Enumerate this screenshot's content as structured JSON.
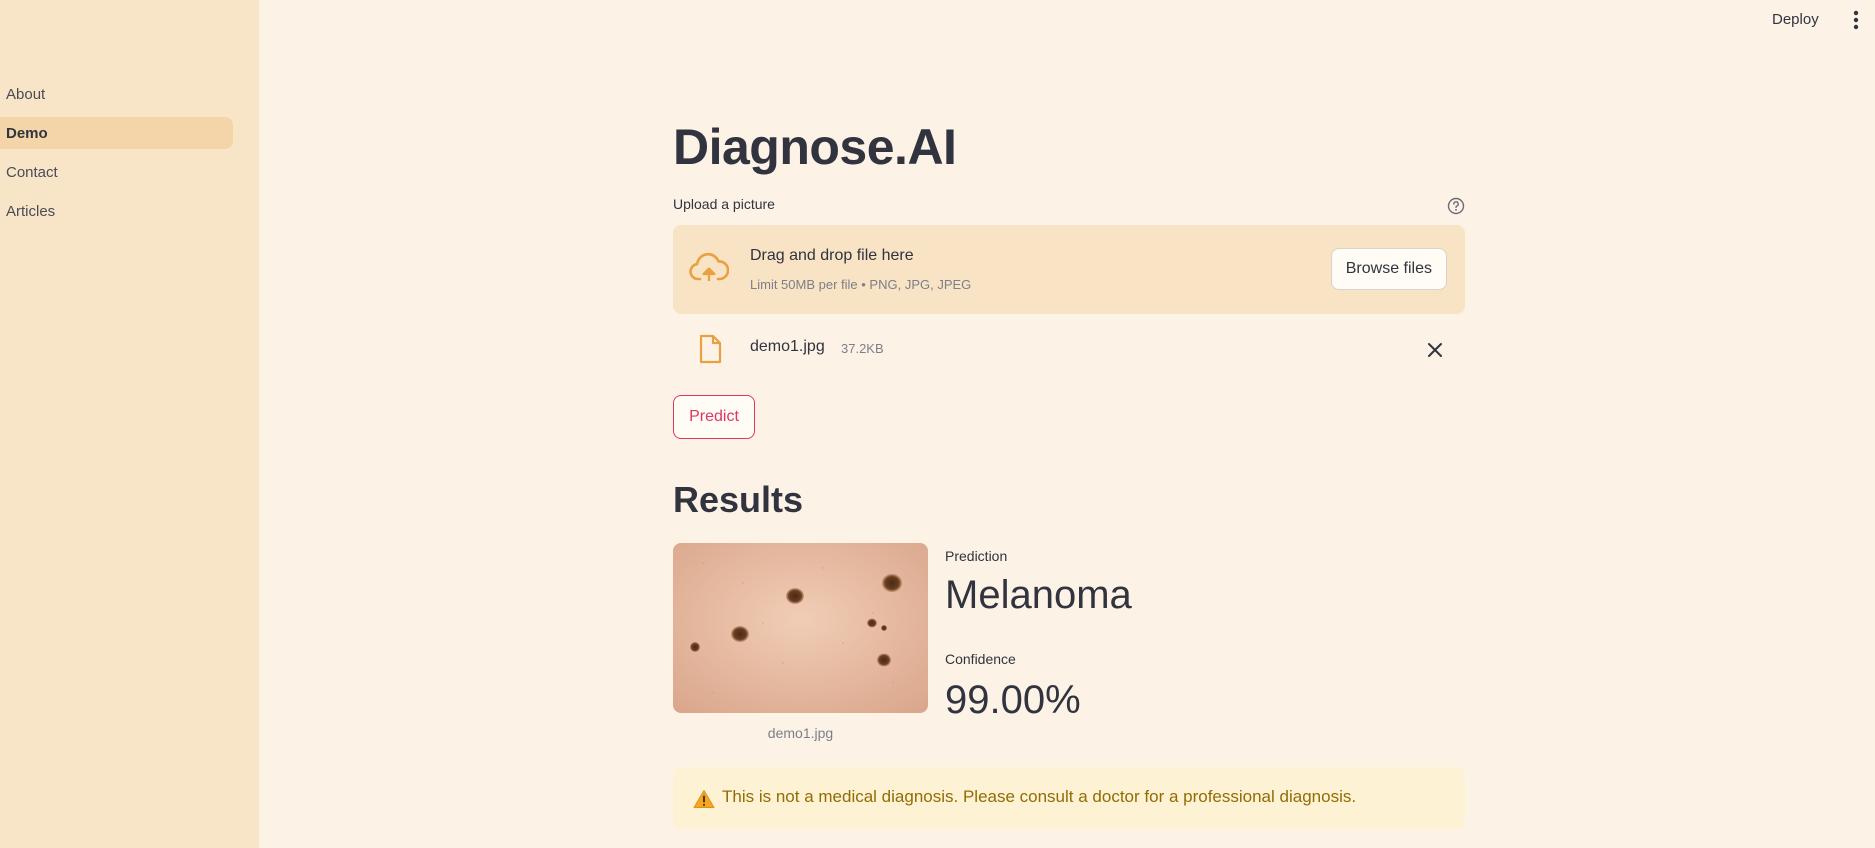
{
  "sidebar": {
    "items": [
      {
        "label": "About",
        "active": false
      },
      {
        "label": "Demo",
        "active": true
      },
      {
        "label": "Contact",
        "active": false
      },
      {
        "label": "Articles",
        "active": false
      }
    ]
  },
  "topbar": {
    "deploy_label": "Deploy",
    "menu_icon": "vertical-ellipsis-icon"
  },
  "main": {
    "title": "Diagnose.AI",
    "uploader": {
      "label": "Upload a picture",
      "help_icon": "question-circle-icon",
      "dropzone_title": "Drag and drop file here",
      "dropzone_subtitle": "Limit 50MB per file • PNG, JPG, JPEG",
      "browse_label": "Browse files",
      "cloud_icon": "cloud-upload-icon"
    },
    "file": {
      "name": "demo1.jpg",
      "size": "37.2KB",
      "icon": "file-icon",
      "remove_icon": "close-icon"
    },
    "predict_label": "Predict",
    "results": {
      "heading": "Results",
      "image_caption": "demo1.jpg",
      "prediction_label": "Prediction",
      "prediction_value": "Melanoma",
      "confidence_label": "Confidence",
      "confidence_value": "99.00%"
    },
    "warning": {
      "icon": "warning-icon",
      "text": "This is not a medical diagnosis. Please consult a doctor for a professional diagnosis."
    }
  },
  "colors": {
    "background": "#fdf2e6",
    "sidebar": "#f8e4c6",
    "accent": "#e0365f",
    "icon_orange": "#e8a040",
    "warning_text": "#926c05",
    "warning_bg": "#fdf2d3"
  }
}
